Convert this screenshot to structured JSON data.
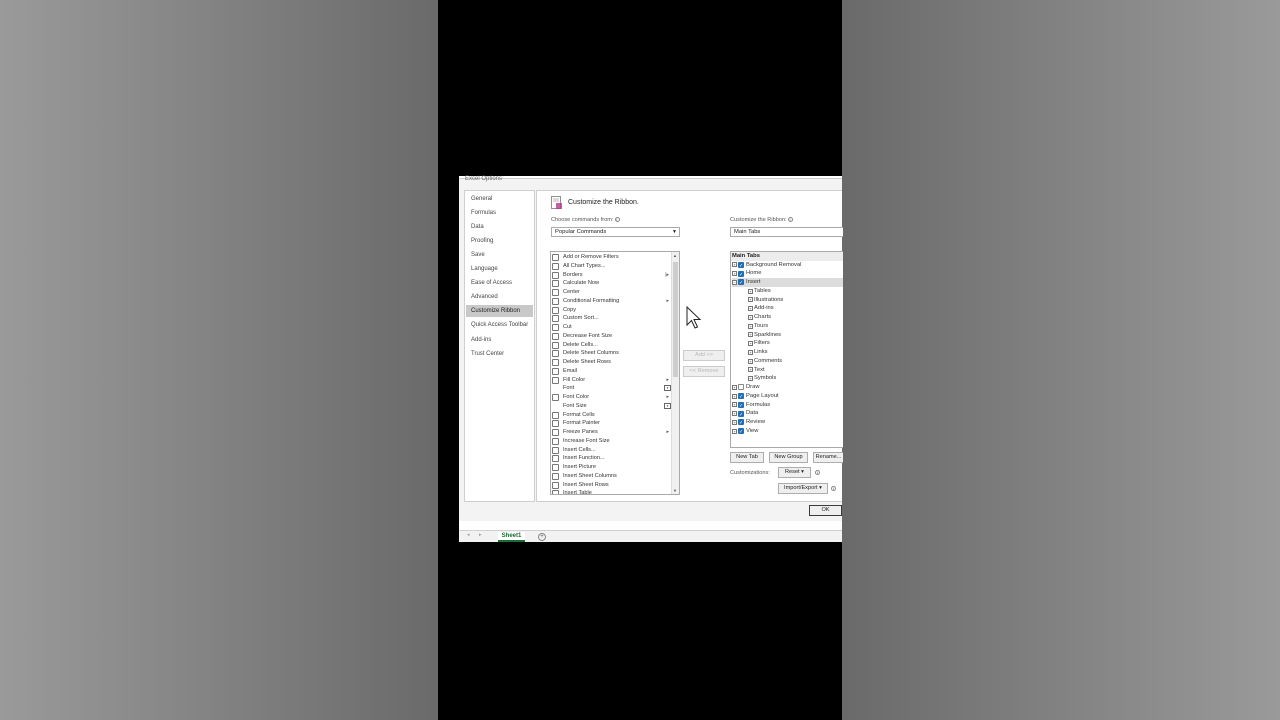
{
  "dialog": {
    "title": "Excel Options"
  },
  "nav": {
    "items": [
      {
        "label": "General"
      },
      {
        "label": "Formulas"
      },
      {
        "label": "Data"
      },
      {
        "label": "Proofing"
      },
      {
        "label": "Save"
      },
      {
        "label": "Language"
      },
      {
        "label": "Ease of Access"
      },
      {
        "label": "Advanced"
      },
      {
        "label": "Customize Ribbon"
      },
      {
        "label": "Quick Access Toolbar"
      },
      {
        "label": "Add-ins"
      },
      {
        "label": "Trust Center"
      }
    ],
    "active": "Customize Ribbon"
  },
  "header": {
    "title": "Customize the Ribbon."
  },
  "left": {
    "choose_label": "Choose commands from:",
    "choose_value": "Popular Commands",
    "commands": [
      {
        "label": "Add or Remove Filters",
        "icon": "filter-icon"
      },
      {
        "label": "All Chart Types...",
        "icon": "chart-icon"
      },
      {
        "label": "Borders",
        "icon": "borders-icon",
        "sub": "|▸"
      },
      {
        "label": "Calculate Now",
        "icon": "calculator-icon"
      },
      {
        "label": "Center",
        "icon": "align-center-icon"
      },
      {
        "label": "Conditional Formatting",
        "icon": "conditional-formatting-icon",
        "sub": "▸"
      },
      {
        "label": "Copy",
        "icon": "copy-icon"
      },
      {
        "label": "Custom Sort...",
        "icon": "sort-icon"
      },
      {
        "label": "Cut",
        "icon": "cut-icon"
      },
      {
        "label": "Decrease Font Size",
        "icon": "font-decrease-icon"
      },
      {
        "label": "Delete Cells...",
        "icon": "delete-cells-icon"
      },
      {
        "label": "Delete Sheet Columns",
        "icon": "delete-columns-icon"
      },
      {
        "label": "Delete Sheet Rows",
        "icon": "delete-rows-icon"
      },
      {
        "label": "Email",
        "icon": "email-icon"
      },
      {
        "label": "Fill Color",
        "icon": "fill-color-icon",
        "sub": "▸"
      },
      {
        "label": "Font",
        "icon": "",
        "box": true
      },
      {
        "label": "Font Color",
        "icon": "font-color-icon",
        "sub": "▸"
      },
      {
        "label": "Font Size",
        "icon": "",
        "box": true
      },
      {
        "label": "Format Cells",
        "icon": "format-cells-icon"
      },
      {
        "label": "Format Painter",
        "icon": "format-painter-icon"
      },
      {
        "label": "Freeze Panes",
        "icon": "freeze-panes-icon",
        "sub": "▸"
      },
      {
        "label": "Increase Font Size",
        "icon": "font-increase-icon"
      },
      {
        "label": "Insert Cells...",
        "icon": "insert-cells-icon"
      },
      {
        "label": "Insert Function...",
        "icon": "function-icon"
      },
      {
        "label": "Insert Picture",
        "icon": "picture-icon"
      },
      {
        "label": "Insert Sheet Columns",
        "icon": "insert-columns-icon"
      },
      {
        "label": "Insert Sheet Rows",
        "icon": "insert-rows-icon"
      },
      {
        "label": "Insert Table",
        "icon": "table-icon"
      }
    ]
  },
  "middle": {
    "add_label": "Add >>",
    "remove_label": "<< Remove"
  },
  "right": {
    "customize_label": "Customize the Ribbon:",
    "customize_value": "Main Tabs",
    "tree_header": "Main Tabs",
    "tabs": [
      {
        "label": "Background Removal",
        "checked": true,
        "level": 0,
        "expander": "+"
      },
      {
        "label": "Home",
        "checked": true,
        "level": 0,
        "expander": "+"
      },
      {
        "label": "Insert",
        "checked": true,
        "level": 0,
        "expander": "−",
        "selected": true
      },
      {
        "label": "Tables",
        "level": 1,
        "expander": "+"
      },
      {
        "label": "Illustrations",
        "level": 1,
        "expander": "+"
      },
      {
        "label": "Add-ins",
        "level": 1,
        "expander": "+"
      },
      {
        "label": "Charts",
        "level": 1,
        "expander": "+"
      },
      {
        "label": "Tours",
        "level": 1,
        "expander": "+"
      },
      {
        "label": "Sparklines",
        "level": 1,
        "expander": "+"
      },
      {
        "label": "Filters",
        "level": 1,
        "expander": "+"
      },
      {
        "label": "Links",
        "level": 1,
        "expander": "+"
      },
      {
        "label": "Comments",
        "level": 1,
        "expander": "+"
      },
      {
        "label": "Text",
        "level": 1,
        "expander": "+"
      },
      {
        "label": "Symbols",
        "level": 1,
        "expander": "+"
      },
      {
        "label": "Draw",
        "checked": false,
        "level": 0,
        "expander": "+"
      },
      {
        "label": "Page Layout",
        "checked": true,
        "level": 0,
        "expander": "+"
      },
      {
        "label": "Formulas",
        "checked": true,
        "level": 0,
        "expander": "+"
      },
      {
        "label": "Data",
        "checked": true,
        "level": 0,
        "expander": "+"
      },
      {
        "label": "Review",
        "checked": true,
        "level": 0,
        "expander": "+"
      },
      {
        "label": "View",
        "checked": true,
        "level": 0,
        "expander": "+"
      }
    ],
    "new_tab": "New Tab",
    "new_group": "New Group",
    "rename": "Rename...",
    "customizations_label": "Customizations:",
    "reset": "Reset ▾",
    "import_export": "Import/Export ▾"
  },
  "footer": {
    "ok": "OK"
  },
  "sheetbar": {
    "sheet_name": "Sheet1",
    "add": "+"
  },
  "colors": {
    "accent": "#1f6fb4",
    "sheet_green": "#1b6b32",
    "selected_nav": "#c8c8c8"
  }
}
